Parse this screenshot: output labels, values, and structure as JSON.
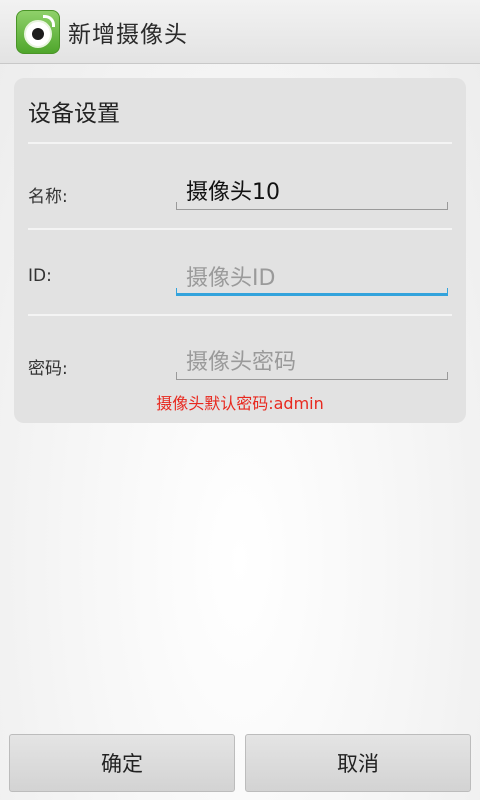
{
  "header": {
    "title": "新增摄像头",
    "icon": "camera-app-icon"
  },
  "card": {
    "title": "设备设置",
    "fields": {
      "name": {
        "label": "名称:",
        "value": "摄像头10",
        "placeholder": ""
      },
      "id": {
        "label": "ID:",
        "value": "",
        "placeholder": "摄像头ID"
      },
      "password": {
        "label": "密码:",
        "value": "",
        "placeholder": "摄像头密码"
      }
    },
    "hint": "摄像头默认密码:admin"
  },
  "buttons": {
    "confirm": "确定",
    "cancel": "取消"
  },
  "colors": {
    "accent_focus": "#33a3dc",
    "hint_red": "#e8281e",
    "icon_green": "#4fa62c"
  }
}
